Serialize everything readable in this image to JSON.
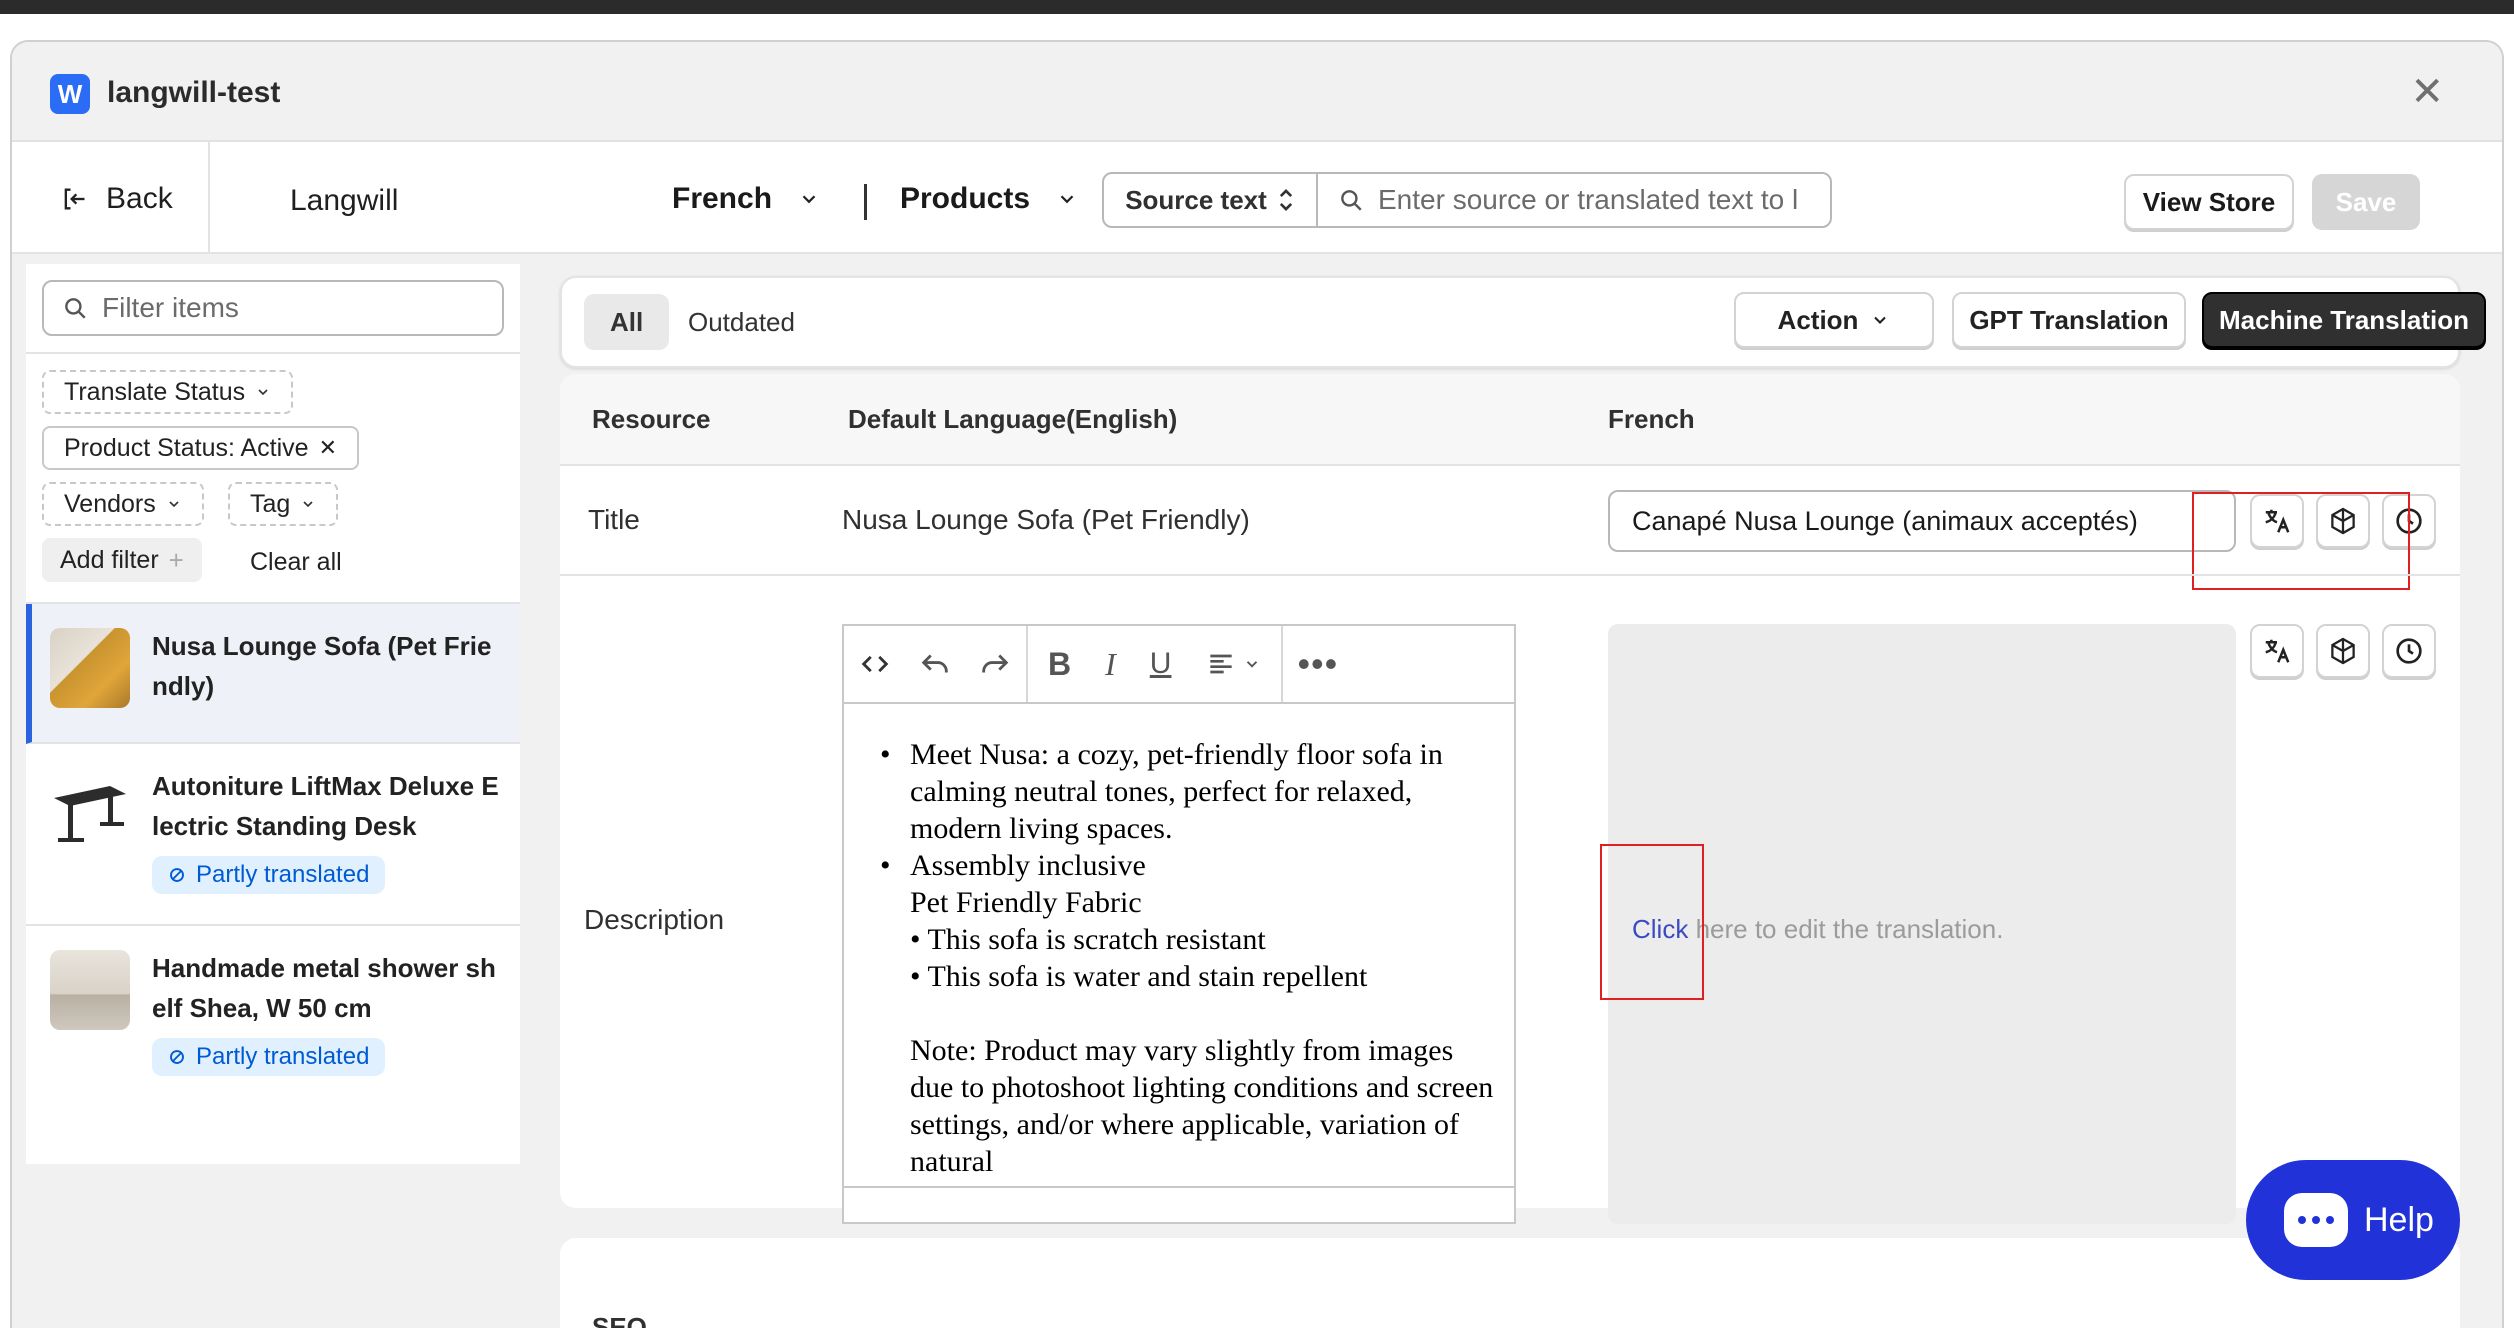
{
  "window": {
    "app_name": "langwill-test",
    "logo_letter": "W"
  },
  "toolbar": {
    "back_label": "Back",
    "brand": "Langwill",
    "language": "French",
    "resource_type": "Products",
    "source_select": "Source text",
    "search_placeholder": "Enter source or translated text to l",
    "view_store": "View Store",
    "save": "Save"
  },
  "sidebar": {
    "filter_placeholder": "Filter items",
    "filters": {
      "translate_status": "Translate Status",
      "product_status": "Product Status: Active",
      "vendors": "Vendors",
      "tag": "Tag",
      "add_filter": "Add filter",
      "clear_all": "Clear all"
    },
    "items": [
      {
        "name": "Nusa Lounge Sofa (Pet Friendly)",
        "status": ""
      },
      {
        "name": "Autoniture LiftMax Deluxe Electric Standing Desk",
        "status": "Partly translated"
      },
      {
        "name": "Handmade metal shower shelf Shea, W 50 cm",
        "status": "Partly translated"
      }
    ]
  },
  "tabs": {
    "all": "All",
    "outdated": "Outdated"
  },
  "actions": {
    "action": "Action",
    "gpt": "GPT Translation",
    "machine": "Machine Translation"
  },
  "table": {
    "headers": {
      "resource": "Resource",
      "default_language": "Default Language(English)",
      "target": "French"
    },
    "title_row": {
      "label": "Title",
      "source": "Nusa Lounge Sofa (Pet Friendly)",
      "translation": "Canapé Nusa Lounge (animaux acceptés)"
    },
    "description_row": {
      "label": "Description",
      "bullets": [
        "Meet Nusa: a cozy, pet-friendly floor sofa in calming neutral tones, perfect for relaxed, modern living spaces.",
        "Assembly inclusive"
      ],
      "lines": [
        "Pet Friendly Fabric",
        "• This sofa is scratch resistant",
        "• This sofa is water and stain repellent"
      ],
      "note": "Note: Product may vary slightly from images due to photoshoot lighting conditions and screen settings, and/or where applicable, variation of natural",
      "placeholder_click": "Click",
      "placeholder_rest": " here to edit the translation."
    }
  },
  "seo": {
    "title": "SEO"
  },
  "help": {
    "label": "Help"
  },
  "colors": {
    "accent": "#2c62e0",
    "help": "#2133d8",
    "badge_bg": "#e0f0ff",
    "badge_text": "#005bd3",
    "highlight": "#e02020"
  }
}
